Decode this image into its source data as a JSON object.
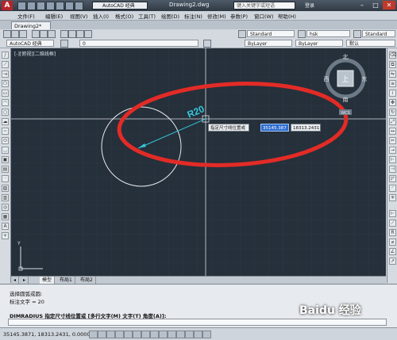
{
  "titlebar": {
    "workspace": "AutoCAD 经典",
    "document_title": "Drawing2.dwg",
    "search_placeholder": "键入关键字或短语",
    "user_label": "登录"
  },
  "menu": [
    "文件(F)",
    "编辑(E)",
    "视图(V)",
    "插入(I)",
    "格式(O)",
    "工具(T)",
    "绘图(D)",
    "标注(N)",
    "修改(M)",
    "参数(P)",
    "窗口(W)",
    "帮助(H)"
  ],
  "doc_tab": "Drawing2*",
  "toolbar": {
    "workspace_combo": "AutoCAD 经典",
    "layer_combo": "0",
    "text_style": "Standard",
    "dim_style": "hsk",
    "table_style": "Standard",
    "color": "ByLayer",
    "linetype": "ByLayer",
    "lineweight": "默认"
  },
  "viewport_label": "[-][俯视][二维线框]",
  "viewcube": {
    "north": "北",
    "south": "南",
    "east": "东",
    "west": "西",
    "face": "上",
    "wcs": "WCS"
  },
  "dimension_text": "R20",
  "dynamic_input": {
    "prompt": "指定尺寸线位置或",
    "x_value": "35145.387",
    "y_value": "18313.2431"
  },
  "ucs_label": "Y",
  "layout_tabs": [
    "模型",
    "布局1",
    "布局2"
  ],
  "command_history": [
    "选择圆弧或圆:",
    "标注文字 = 20"
  ],
  "command_prompt": "DIMRADIUS 指定尺寸线位置或 [多行文字(M) 文字(T) 角度(A)]:",
  "status": {
    "coordinates": "35145.3871, 18313.2431, 0.0000"
  },
  "watermark": "Baidu 经验",
  "colors": {
    "canvas": "#25303b",
    "highlight_ellipse": "#e32b26",
    "dimension": "#35c8da",
    "circle": "#e8eaec"
  }
}
